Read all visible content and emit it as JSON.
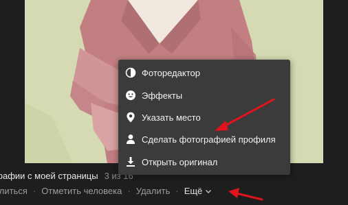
{
  "caption": {
    "title": "графии с моей страницы",
    "count": "3 из 16"
  },
  "actions": {
    "share": "елиться",
    "tag_person": "Отметить человека",
    "delete": "Удалить",
    "more": "Ещё",
    "separator": "·"
  },
  "menu": {
    "items": [
      {
        "label": "Фоторедактор",
        "icon": "contrast-icon"
      },
      {
        "label": "Эффекты",
        "icon": "smiley-icon"
      },
      {
        "label": "Указать место",
        "icon": "location-pin-icon"
      },
      {
        "label": "Сделать фотографией профиля",
        "icon": "user-icon"
      },
      {
        "label": "Открыть оригинал",
        "icon": "download-icon"
      }
    ]
  },
  "colors": {
    "background": "#1e1e1e",
    "menu_background": "#3b3b3b",
    "annotation_arrow": "#e0141e",
    "photo_background": "#d6dab2"
  }
}
